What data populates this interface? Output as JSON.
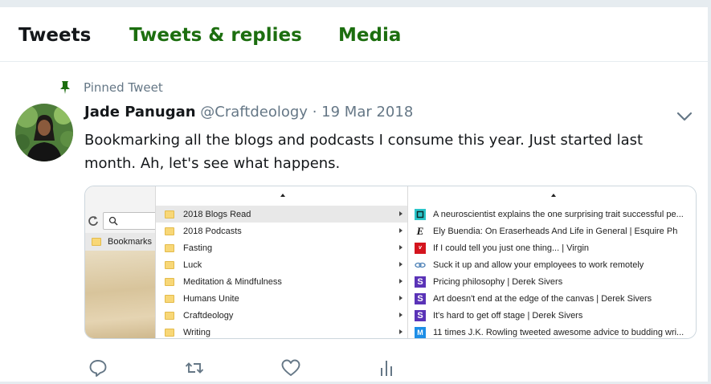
{
  "tabs": [
    {
      "label": "Tweets",
      "active": true
    },
    {
      "label": "Tweets & replies",
      "active": false
    },
    {
      "label": "Media",
      "active": false
    }
  ],
  "tweet": {
    "pinned_label": "Pinned Tweet",
    "name": "Jade Panugan",
    "handle": "@Craftdeology",
    "separator": "·",
    "date": "19 Mar 2018",
    "text": "Bookmarking all the blogs and podcasts I consume this year. Just started last month. Ah, let's see what happens."
  },
  "screenshot": {
    "left_pane": {
      "bookmarks_label": "Bookmarks"
    },
    "folders": [
      "2018 Blogs Read",
      "2018 Podcasts",
      "Fasting",
      "Luck",
      "Meditation & Mindfulness",
      "Humans Unite",
      "Craftdeology",
      "Writing"
    ],
    "links": [
      {
        "label": "A neuroscientist explains the one surprising trait successful pe...",
        "icon": "quartz-icon"
      },
      {
        "label": "Ely Buendia: On Eraserheads And Life in General | Esquire Ph",
        "icon": "esquire-icon"
      },
      {
        "label": "If I could tell you just one thing... | Virgin",
        "icon": "virgin-icon"
      },
      {
        "label": "Suck it up and allow your employees to work remotely",
        "icon": "link-chain-icon"
      },
      {
        "label": "Pricing philosophy | Derek Sivers",
        "icon": "sivers-icon"
      },
      {
        "label": "Art doesn't end at the edge of the canvas | Derek Sivers",
        "icon": "sivers-icon"
      },
      {
        "label": "It's hard to get off stage | Derek Sivers",
        "icon": "sivers-icon"
      },
      {
        "label": "11 times J.K. Rowling tweeted awesome advice to budding wri...",
        "icon": "medium-icon"
      }
    ]
  },
  "colors": {
    "accent_green": "#1c6e0f",
    "text_primary": "#14171a",
    "text_secondary": "#657786",
    "border": "#e6ecf0"
  }
}
